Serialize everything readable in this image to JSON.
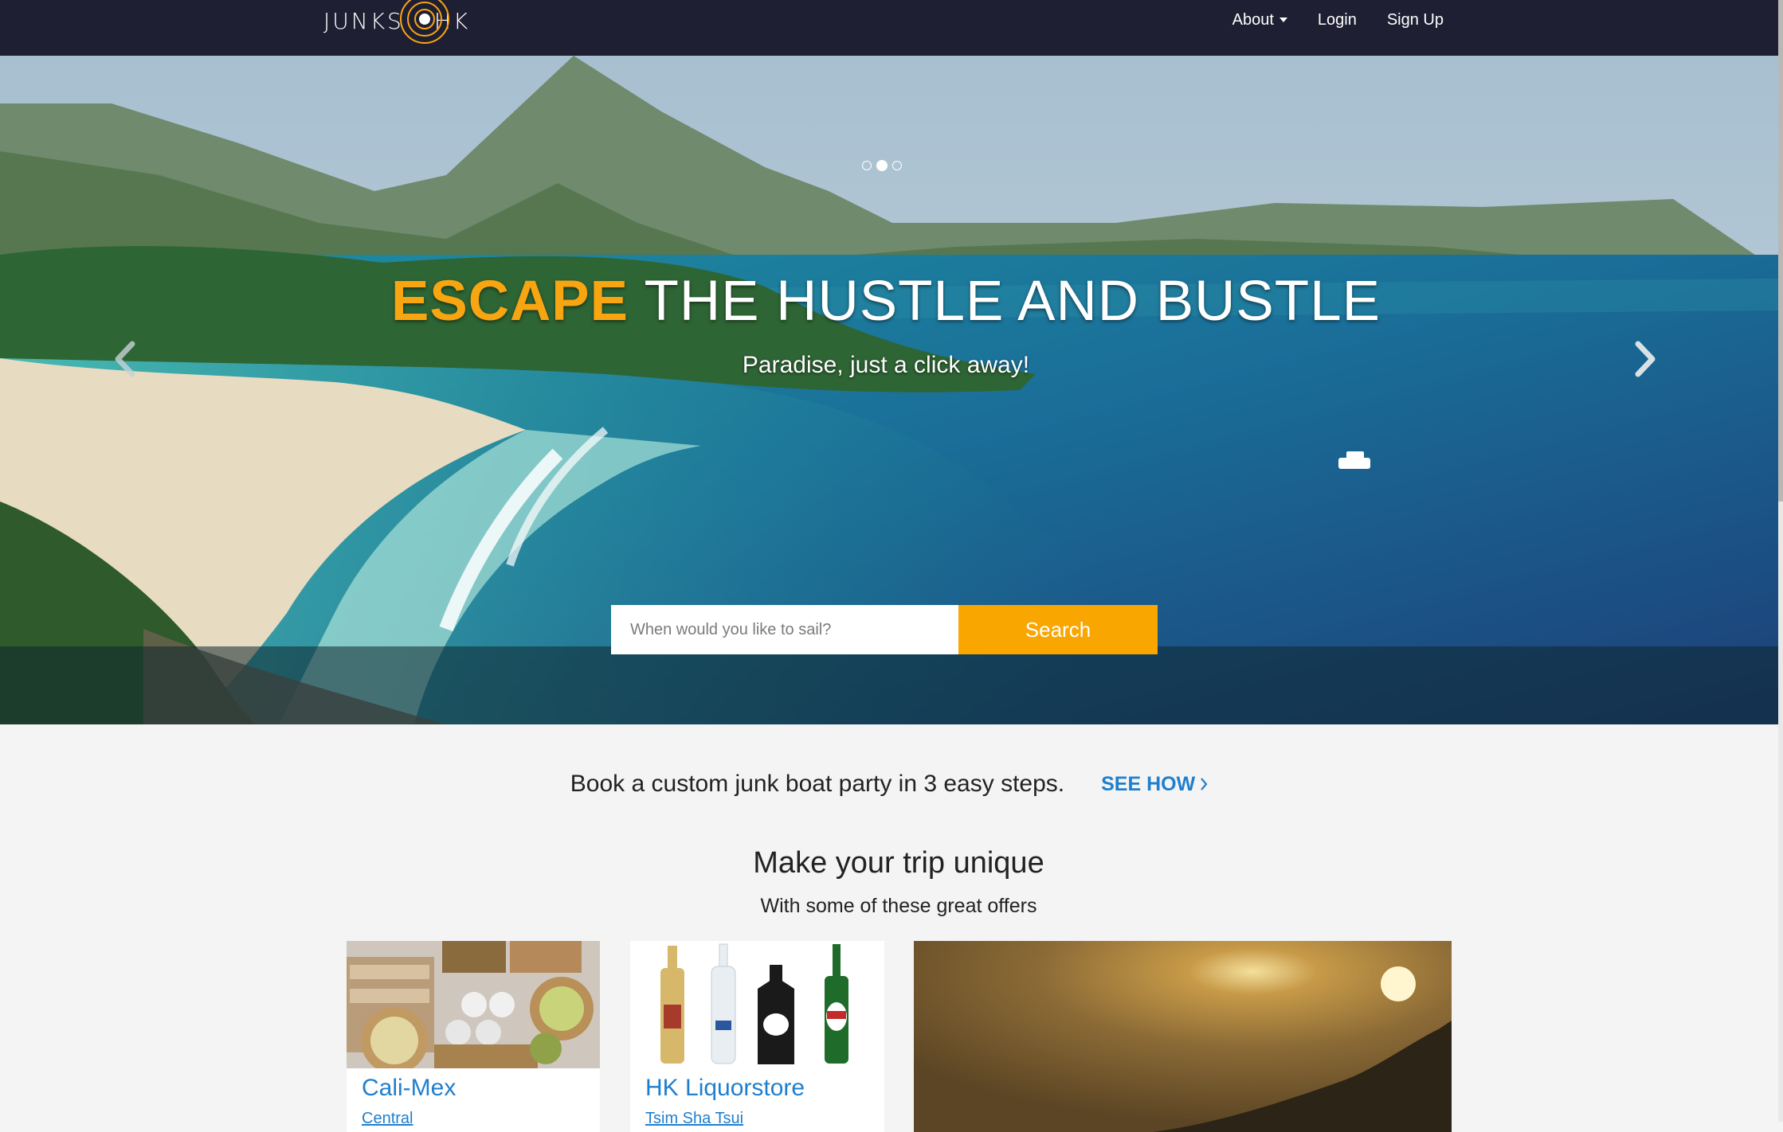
{
  "brand": {
    "logo_left": "JUNKS",
    "logo_right": "HK",
    "accent_color": "#f8a512"
  },
  "nav": {
    "about": "About",
    "login": "Login",
    "signup": "Sign Up"
  },
  "hero": {
    "headline_accent": "ESCAPE",
    "headline_rest": " THE HUSTLE AND BUSTLE",
    "subheadline": "Paradise, just a click away!",
    "slides_total": 3,
    "slide_active": 2,
    "search_placeholder": "When would you like to sail?",
    "search_button": "Search"
  },
  "howto": {
    "text": "Book a custom junk boat party in 3 easy steps.",
    "link": "SEE HOW"
  },
  "offers": {
    "title": "Make your trip unique",
    "subtitle": "With some of these great offers",
    "cards": [
      {
        "title": "Cali-Mex",
        "location": "Central"
      },
      {
        "title": "HK Liquorstore",
        "location": "Tsim Sha Tsui"
      },
      {
        "title": "",
        "location": ""
      }
    ]
  },
  "colors": {
    "navbar": "#1f1f33",
    "link": "#1f7fce",
    "search_button": "#f9a601",
    "page_bg": "#f4f4f4"
  }
}
